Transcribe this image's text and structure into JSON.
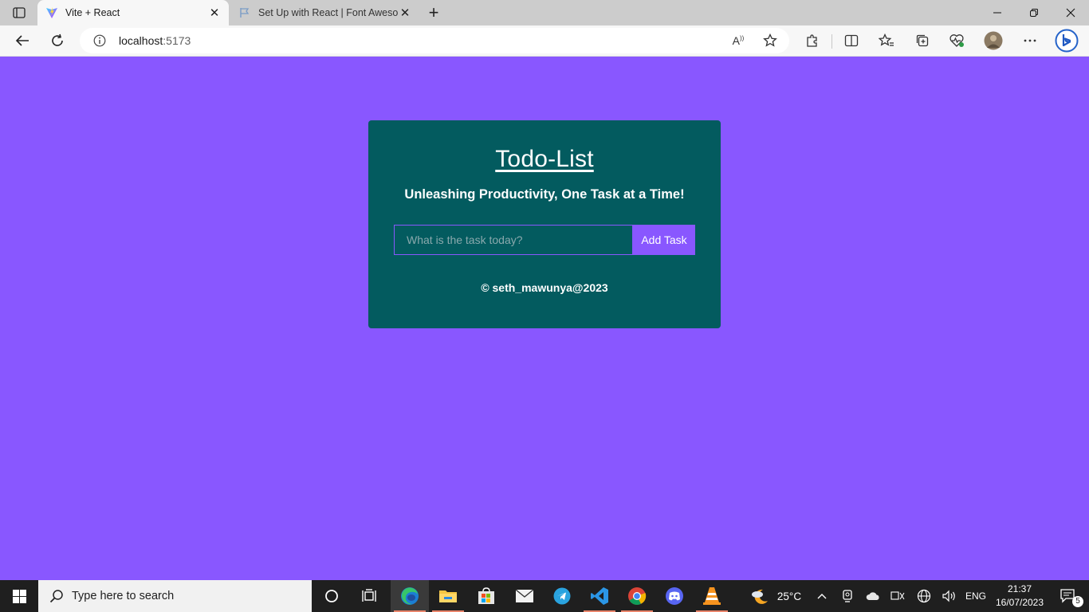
{
  "browser": {
    "tabs": [
      {
        "title": "Vite + React",
        "active": true
      },
      {
        "title": "Set Up with React | Font Awesome",
        "active": false
      }
    ],
    "url": {
      "host": "localhost",
      "port": ":5173"
    }
  },
  "app": {
    "title": "Todo-List",
    "subtitle": "Unleashing Productivity, One Task at a Time!",
    "input_placeholder": "What is the task today?",
    "add_button": "Add Task",
    "footer": "© seth_mawunya@2023"
  },
  "taskbar": {
    "search_placeholder": "Type here to search",
    "weather": "25°C",
    "language": "ENG",
    "time": "21:37",
    "date": "16/07/2023",
    "notifications": "5"
  },
  "colors": {
    "page_bg": "#8957ff",
    "card_bg": "#035b5f",
    "accent": "#8957ff"
  }
}
